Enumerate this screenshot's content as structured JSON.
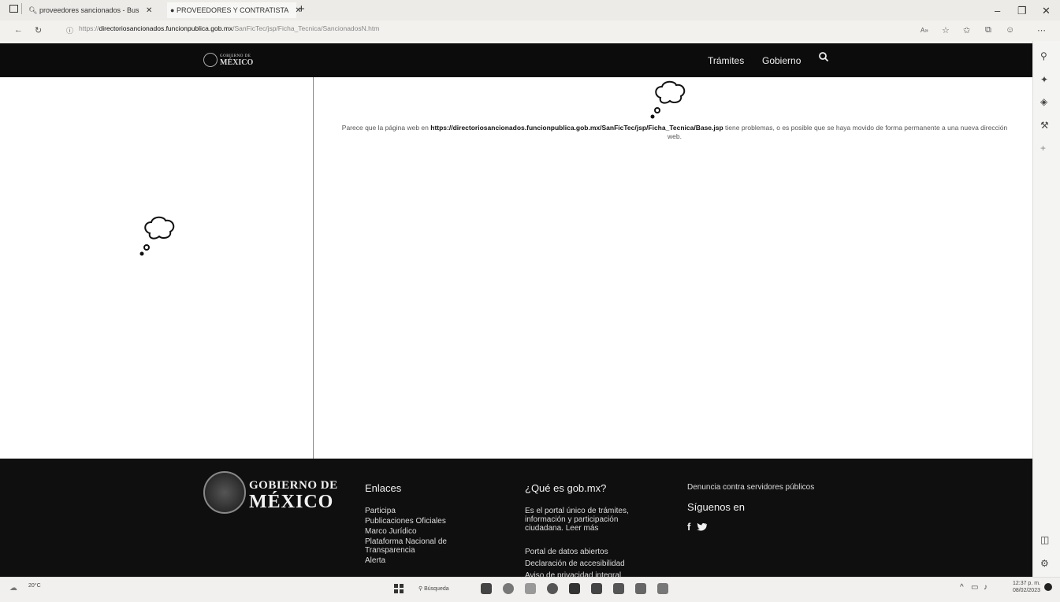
{
  "browser": {
    "tabs": [
      {
        "label": "proveedores sancionados - Bus",
        "icon": "search-icon"
      },
      {
        "label": "PROVEEDORES Y CONTRATISTA",
        "icon": "circle-icon"
      }
    ],
    "url": {
      "prefix": "https://",
      "domain": "directoriosancionados.funcionpublica.gob.mx",
      "path": "/SanFicTec/jsp/Ficha_Tecnica/SancionadosN.htm"
    }
  },
  "site_header": {
    "logo_line1": "GOBIERNO DE",
    "logo_line2": "MÉXICO",
    "nav": [
      "Trámites",
      "Gobierno"
    ]
  },
  "error_message": {
    "prefix": "Parece que la página web en ",
    "url": "https://directoriosancionados.funcionpublica.gob.mx/SanFicTec/jsp/Ficha_Tecnica/Base.jsp",
    "suffix": " tiene problemas, o es posible que se haya movido de forma permanente a una nueva dirección web."
  },
  "footer": {
    "logo_line1": "GOBIERNO DE",
    "logo_line2": "MÉXICO",
    "enlaces": {
      "heading": "Enlaces",
      "links": [
        "Participa",
        "Publicaciones Oficiales",
        "Marco Jurídico",
        "Plataforma Nacional de Transparencia",
        "Alerta"
      ]
    },
    "que_es": {
      "heading": "¿Qué es gob.mx?",
      "description": "Es el portal único de trámites, información y participación ciudadana. Leer más",
      "links": [
        "Portal de datos abiertos",
        "Declaración de accesibilidad",
        "Aviso de privacidad integral"
      ]
    },
    "denuncia": "Denuncia contra servidores públicos",
    "siguenos": "Síguenos en"
  },
  "taskbar": {
    "weather_temp": "20°C",
    "search_label": "Búsqueda",
    "time": "12:37 p. m.",
    "date": "08/02/2023"
  }
}
